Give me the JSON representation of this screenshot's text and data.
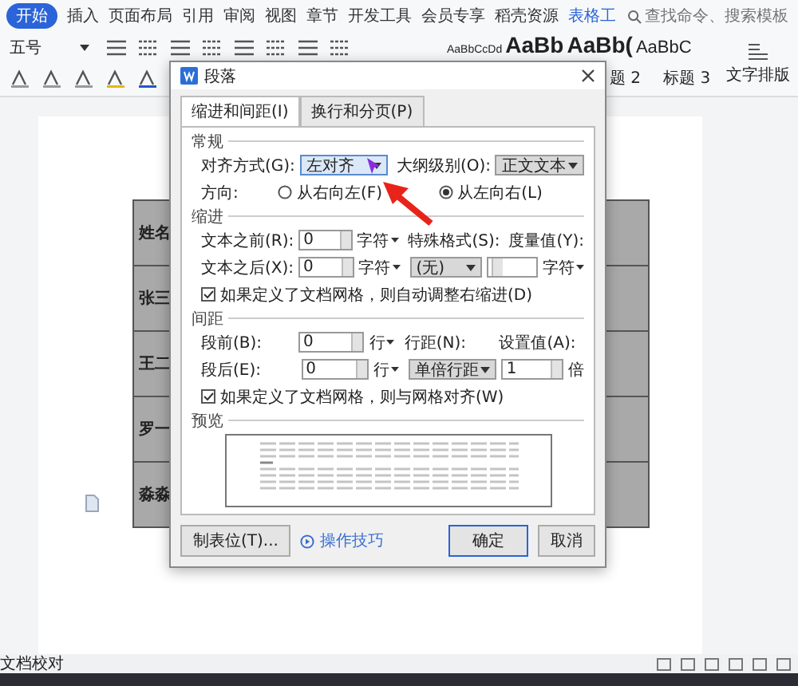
{
  "ribbon": {
    "tabs": [
      {
        "label": "开始",
        "selected": true
      },
      {
        "label": "插入",
        "selected": false
      },
      {
        "label": "页面布局",
        "selected": false
      },
      {
        "label": "引用",
        "selected": false
      },
      {
        "label": "审阅",
        "selected": false
      },
      {
        "label": "视图",
        "selected": false
      },
      {
        "label": "章节",
        "selected": false
      },
      {
        "label": "开发工具",
        "selected": false
      },
      {
        "label": "会员专享",
        "selected": false
      },
      {
        "label": "稻壳资源",
        "selected": false
      },
      {
        "label": "表格工",
        "selected": false
      }
    ],
    "search": {
      "placeholder": "查找命令、搜索模板"
    },
    "font_size": "五号",
    "styles": [
      {
        "sample": "AaBbCcDd",
        "kind": "body"
      },
      {
        "sample": "AaBb",
        "kind": "heading"
      },
      {
        "sample": "AaBb(",
        "kind": "heading"
      },
      {
        "sample": "AaBbC",
        "kind": "subheading"
      }
    ],
    "style_labels": [
      "题 2",
      "标题 3"
    ],
    "text_layout": "文字排版"
  },
  "document": {
    "table_rows": [
      "姓名",
      "张三",
      "王二",
      "罗一",
      "淼淼"
    ]
  },
  "dialog": {
    "title": "段落",
    "tabs": [
      {
        "label": "缩进和间距(I)",
        "selected": true
      },
      {
        "label": "换行和分页(P)",
        "selected": false
      }
    ],
    "general": {
      "title": "常规",
      "alignment": {
        "label": "对齐方式(G):",
        "value": "左对齐"
      },
      "outline": {
        "label": "大纲级别(O):",
        "value": "正文文本"
      },
      "direction": {
        "label": "方向:",
        "options": [
          {
            "label": "从右向左(F)",
            "selected": false
          },
          {
            "label": "从左向右(L)",
            "selected": true
          }
        ]
      }
    },
    "indent": {
      "title": "缩进",
      "before": {
        "label": "文本之前(R):",
        "value": "0",
        "unit": "字符"
      },
      "after": {
        "label": "文本之后(X):",
        "value": "0",
        "unit": "字符"
      },
      "special": {
        "label": "特殊格式(S):",
        "value": "(无)"
      },
      "measure": {
        "label": "度量值(Y):",
        "unit": "字符"
      },
      "grid_check": {
        "label": "如果定义了文档网格，则自动调整右缩进(D)",
        "checked": true
      }
    },
    "spacing": {
      "title": "间距",
      "before": {
        "label": "段前(B):",
        "value": "0",
        "unit": "行"
      },
      "after": {
        "label": "段后(E):",
        "value": "0",
        "unit": "行"
      },
      "line_spacing": {
        "label": "行距(N):",
        "value": "单倍行距"
      },
      "set_value": {
        "label": "设置值(A):",
        "value": "1",
        "unit": "倍"
      },
      "grid_check": {
        "label": "如果定义了文档网格，则与网格对齐(W)",
        "checked": true
      }
    },
    "preview": {
      "title": "预览"
    },
    "buttons": {
      "tabs": "制表位(T)...",
      "tips": "操作技巧",
      "ok": "确定",
      "cancel": "取消"
    }
  },
  "status_bar": {
    "text": "文档校对"
  }
}
